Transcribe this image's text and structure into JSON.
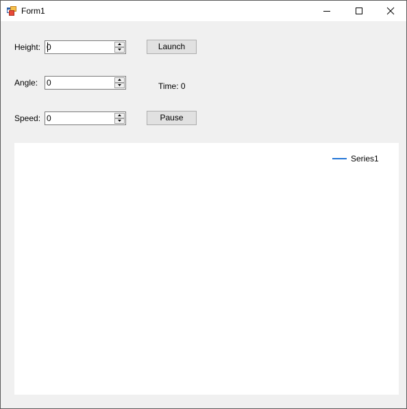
{
  "window": {
    "title": "Form1",
    "icon": "winforms-app-icon"
  },
  "controls": {
    "height": {
      "label": "Height:",
      "value": "0"
    },
    "angle": {
      "label": "Angle:",
      "value": "0"
    },
    "speed": {
      "label": "Speed:",
      "value": "0"
    }
  },
  "buttons": {
    "launch": "Launch",
    "pause": "Pause"
  },
  "status": {
    "time": "Time: 0"
  },
  "chart_data": {
    "type": "line",
    "series": [
      {
        "name": "Series1",
        "color": "#1e73d6",
        "values": []
      }
    ],
    "legend": "top-right"
  }
}
